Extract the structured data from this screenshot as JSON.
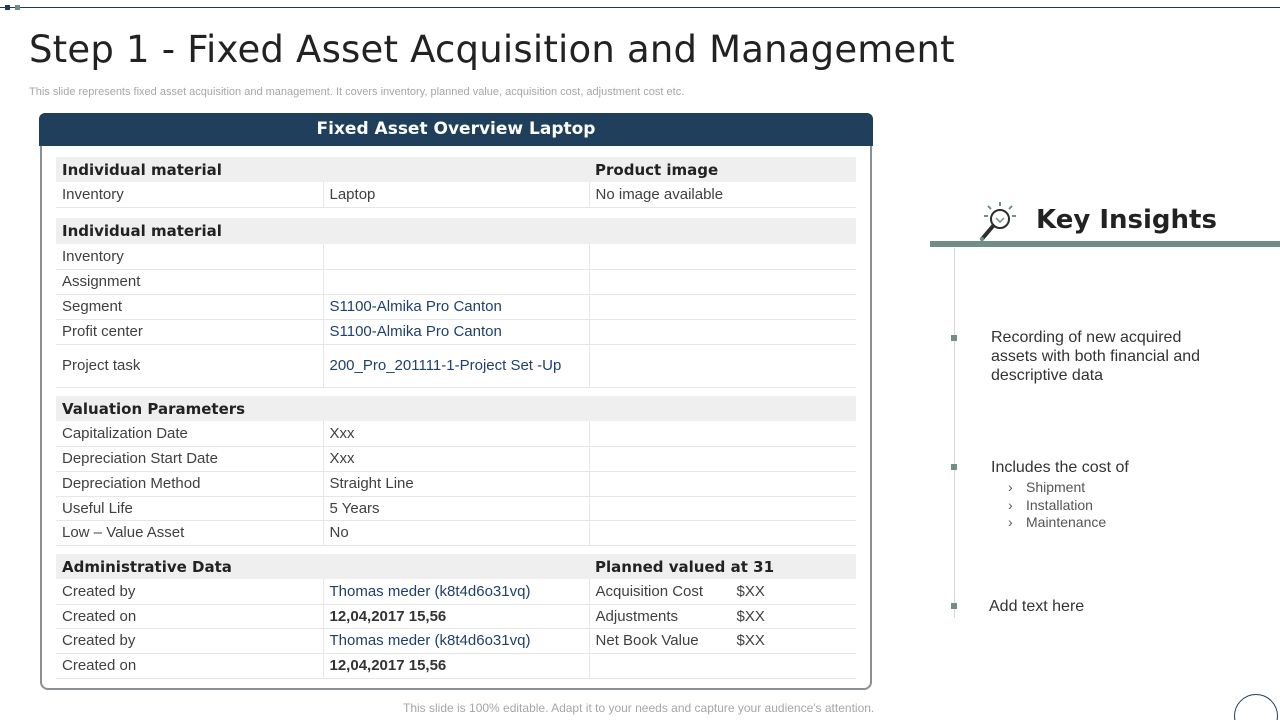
{
  "slide": {
    "title": "Step 1 - Fixed Asset Acquisition and Management",
    "subtitle": "This slide represents fixed asset acquisition and management. It covers inventory,  planned value, acquisition cost, adjustment cost etc.",
    "footer": "This slide is 100% editable. Adapt it to your needs and capture your audience's attention."
  },
  "card": {
    "header": "Fixed Asset Overview Laptop",
    "section1": {
      "col1_header": "Individual material",
      "col3_header": "Product image",
      "row": {
        "label": "Inventory",
        "value": "Laptop",
        "image_text": "No image available"
      }
    },
    "section2": {
      "header": "Individual material",
      "rows": [
        {
          "label": "Inventory",
          "value": ""
        },
        {
          "label": "Assignment",
          "value": ""
        },
        {
          "label": "Segment",
          "value": "S1100-Almika Pro Canton"
        },
        {
          "label": "Profit center",
          "value": "S1100-Almika Pro Canton"
        },
        {
          "label": "Project task",
          "value": "200_Pro_201111-1-Project Set -Up"
        }
      ]
    },
    "section3": {
      "header": "Valuation Parameters",
      "rows": [
        {
          "label": "Capitalization Date",
          "value": "Xxx"
        },
        {
          "label": "Depreciation Start Date",
          "value": "Xxx"
        },
        {
          "label": "Depreciation Method",
          "value": "Straight Line"
        },
        {
          "label": "Useful Life",
          "value": "5 Years"
        },
        {
          "label": "Low – Value Asset",
          "value": "No"
        }
      ]
    },
    "section4": {
      "col1_header": "Administrative Data",
      "col3_header": "Planned valued at 31",
      "rows": [
        {
          "label": "Created by",
          "value": "Thomas meder (k8t4d6o31vq)",
          "cost_label": "Acquisition Cost",
          "cost_value": "$XX"
        },
        {
          "label": "Created on",
          "value": "12,04,2017 15,56",
          "cost_label": "Adjustments",
          "cost_value": "$XX"
        },
        {
          "label": "Created by",
          "value": "Thomas meder (k8t4d6o31vq)",
          "cost_label": "Net Book Value",
          "cost_value": "$XX"
        },
        {
          "label": "Created on",
          "value": "12,04,2017 15,56",
          "cost_label": "",
          "cost_value": ""
        }
      ]
    }
  },
  "insights": {
    "title": "Key Insights",
    "icon": "lightbulb-magnifier-icon",
    "item1": "Recording of new acquired assets with both financial and descriptive data",
    "item2": "Includes the cost of",
    "item2_sub": [
      "Shipment",
      "Installation",
      "Maintenance"
    ],
    "item3": "Add text here"
  },
  "colors": {
    "header_bg": "#1f3f5c",
    "accent_green": "#6f8f82",
    "value_blue": "#1f3f6c"
  }
}
